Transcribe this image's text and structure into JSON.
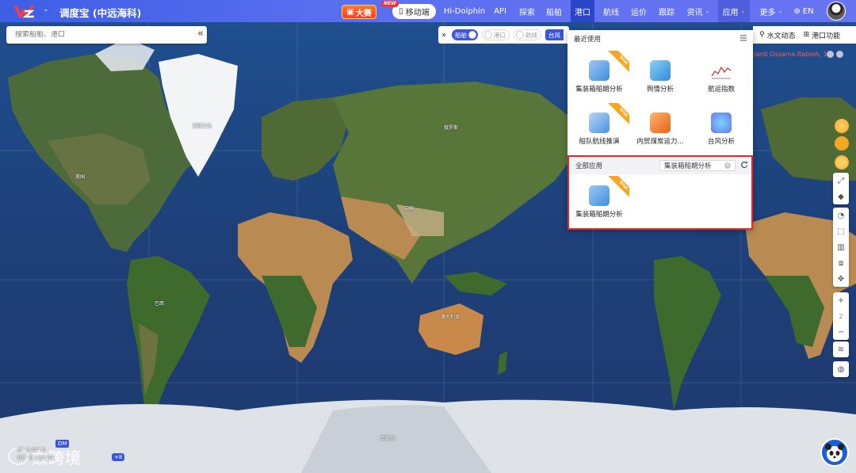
{
  "header": {
    "app_title": "调度宝 (中远海科)",
    "live_badge": "大赛",
    "new_badge": "NEW",
    "mobile_button": "移动端",
    "nav": [
      {
        "label": "Hi-Dolphin"
      },
      {
        "label": "API"
      },
      {
        "label": "探索"
      },
      {
        "label": "船舶"
      },
      {
        "label": "港口",
        "active": true
      },
      {
        "label": "航线"
      },
      {
        "label": "运价"
      },
      {
        "label": "跟踪"
      },
      {
        "label": "资讯"
      },
      {
        "label": "应用"
      },
      {
        "label": "更多"
      },
      {
        "label": "EN"
      }
    ]
  },
  "search": {
    "placeholder": "搜索船舶、港口"
  },
  "layer_toggles": {
    "ship": "船舶",
    "port": "港口",
    "route": "航线",
    "typhoon": "台风"
  },
  "top_right": {
    "hydro": "水文动态",
    "port_func": "港口功能",
    "ship_name": "lardi Ossama Rabieh, 1"
  },
  "apps_panel": {
    "recent_title": "最近使用",
    "recent": [
      {
        "label": "集装箱船期分析",
        "icon": "container-schedule-icon",
        "trial": "Trial"
      },
      {
        "label": "舆情分析",
        "icon": "sentiment-icon"
      },
      {
        "label": "航运指数",
        "icon": "shipping-index-icon"
      },
      {
        "label": "船队航线推演",
        "icon": "fleet-route-icon",
        "trial": "Trial"
      },
      {
        "label": "内贸煤炭运力...",
        "icon": "coal-capacity-icon"
      },
      {
        "label": "台风分析",
        "icon": "typhoon-icon"
      }
    ],
    "all_title": "全部应用",
    "search_value": "集装箱船期分析",
    "all": [
      {
        "label": "集装箱船期分析",
        "icon": "container-schedule-icon",
        "trial": "Trial"
      }
    ]
  },
  "zoom_level": "2",
  "bottom": {
    "coord_lat": "0° 0.42' N",
    "coord_lon": "01° 0.130' W",
    "dm": "DM",
    "watermark": "数跨境",
    "more_count": "+8"
  },
  "map_labels": [
    "格陵兰岛",
    "美国",
    "巴西",
    "俄罗斯",
    "中国",
    "澳大利亚",
    "南极洲"
  ],
  "colors": {
    "accent": "#3a55e0",
    "highlight_border": "#e12b2b",
    "trial": "#f5a623"
  }
}
